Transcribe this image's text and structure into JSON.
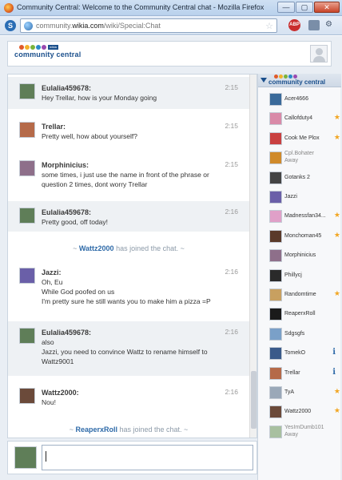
{
  "window": {
    "title": "Community Central: Welcome to the Community Central chat - Mozilla Firefox",
    "min": "—",
    "max": "▢",
    "close": "✕"
  },
  "navbar": {
    "url_prefix": "community.",
    "url_domain": "wikia.com",
    "url_path": "/wiki/Special:Chat",
    "skype": "S",
    "abp": "ABP"
  },
  "header": {
    "logo_text": "community central",
    "logo_badge": "wikia"
  },
  "messages": [
    {
      "user": "Eulalia459678:",
      "time": "2:15",
      "lines": [
        "Hey Trellar, how is your Monday going"
      ],
      "alt": true,
      "avatar_color": "#5f7e58"
    },
    {
      "user": "Trellar:",
      "time": "2:15",
      "lines": [
        "Pretty well, how about yourself?"
      ],
      "alt": false,
      "avatar_color": "#b56a49"
    },
    {
      "user": "Morphinicius:",
      "time": "2:15",
      "lines": [
        "some times, i just use the name in front of the phrase or",
        "question 2 times, dont worry Trellar"
      ],
      "alt": false,
      "avatar_color": "#8e6f8a"
    },
    {
      "user": "Eulalia459678:",
      "time": "2:16",
      "lines": [
        "Pretty good, off today!"
      ],
      "alt": true,
      "avatar_color": "#5f7e58"
    },
    {
      "user": "Jazzi:",
      "time": "2:16",
      "lines": [
        "Oh, Eu",
        "While God poofed on us",
        "I'm pretty sure he still wants you to make him a pizza =P"
      ],
      "alt": false,
      "avatar_color": "#6a5fa8"
    },
    {
      "user": "Eulalia459678:",
      "time": "2:16",
      "lines": [
        "also",
        "Jazzi, you need to convince Wattz to rename himself to",
        "Wattz9001"
      ],
      "alt": true,
      "avatar_color": "#5f7e58"
    },
    {
      "user": "Wattz2000:",
      "time": "2:16",
      "lines": [
        "Nou!"
      ],
      "alt": false,
      "avatar_color": "#6b4a3a"
    }
  ],
  "inline_alerts": [
    {
      "prefix": "~ ",
      "user": "Wattz2000",
      "suffix": " has joined the chat. ~"
    },
    {
      "prefix": "~ ",
      "user": "ReaperxRoll",
      "suffix": " has joined the chat. ~"
    }
  ],
  "userlist": {
    "header_label": "community central",
    "users": [
      {
        "name": "Acer4666",
        "status": "",
        "badge": "",
        "color": "#3a6a9a"
      },
      {
        "name": "Callofduty4",
        "status": "",
        "badge": "star",
        "color": "#d98aa8"
      },
      {
        "name": "Cook Me Plox",
        "status": "",
        "badge": "star",
        "color": "#c94040"
      },
      {
        "name": "Cpl.Bohater",
        "status": "Away",
        "badge": "",
        "color": "#d08a2a"
      },
      {
        "name": "Gotanks 2",
        "status": "",
        "badge": "",
        "color": "#444444"
      },
      {
        "name": "Jazzi",
        "status": "",
        "badge": "",
        "color": "#6a5fa8"
      },
      {
        "name": "Madnessfan34...",
        "status": "",
        "badge": "star",
        "color": "#e0a0c8"
      },
      {
        "name": "Monchoman45",
        "status": "",
        "badge": "star",
        "color": "#5a3a2a"
      },
      {
        "name": "Morphinicius",
        "status": "",
        "badge": "",
        "color": "#8e6f8a"
      },
      {
        "name": "Phillycj",
        "status": "",
        "badge": "",
        "color": "#2a2a2a"
      },
      {
        "name": "Randomtime",
        "status": "",
        "badge": "star",
        "color": "#c8a060"
      },
      {
        "name": "ReaperxRoll",
        "status": "",
        "badge": "",
        "color": "#1a1a1a"
      },
      {
        "name": "Sdgsgfs",
        "status": "",
        "badge": "",
        "color": "#7aa0c8"
      },
      {
        "name": "TomekO",
        "status": "",
        "badge": "info",
        "color": "#3a5a8a"
      },
      {
        "name": "Trellar",
        "status": "",
        "badge": "info",
        "color": "#b56a49"
      },
      {
        "name": "TyA",
        "status": "",
        "badge": "star",
        "color": "#9aa8b8"
      },
      {
        "name": "Wattz2000",
        "status": "",
        "badge": "star",
        "color": "#6b4a3a"
      },
      {
        "name": "YesImDumb101",
        "status": "Away",
        "badge": "",
        "color": "#a8c0a0"
      }
    ]
  },
  "input": {
    "value": "",
    "avatar_color": "#5f7e58"
  },
  "colors": {
    "accent": "#1a4f8c",
    "link": "#2e6aa8",
    "star": "#f2a623"
  }
}
